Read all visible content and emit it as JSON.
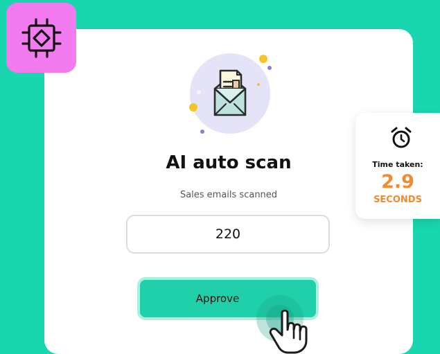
{
  "colors": {
    "background": "#19D6AE",
    "card": "#FFFFFF",
    "badge": "#F27BF0",
    "accent_green": "#1FD0AA",
    "accent_orange": "#F28A2E"
  },
  "scan_card": {
    "title": "AI auto scan",
    "subtitle": "Sales emails scanned",
    "count": "220",
    "approve_label": "Approve"
  },
  "timer": {
    "label": "Time taken:",
    "value": "2.9",
    "unit": "SECONDS"
  },
  "icons": {
    "badge": "chip-icon",
    "hero": "envelope-document-icon",
    "timer": "alarm-clock-icon",
    "cursor": "hand-pointer-icon"
  }
}
